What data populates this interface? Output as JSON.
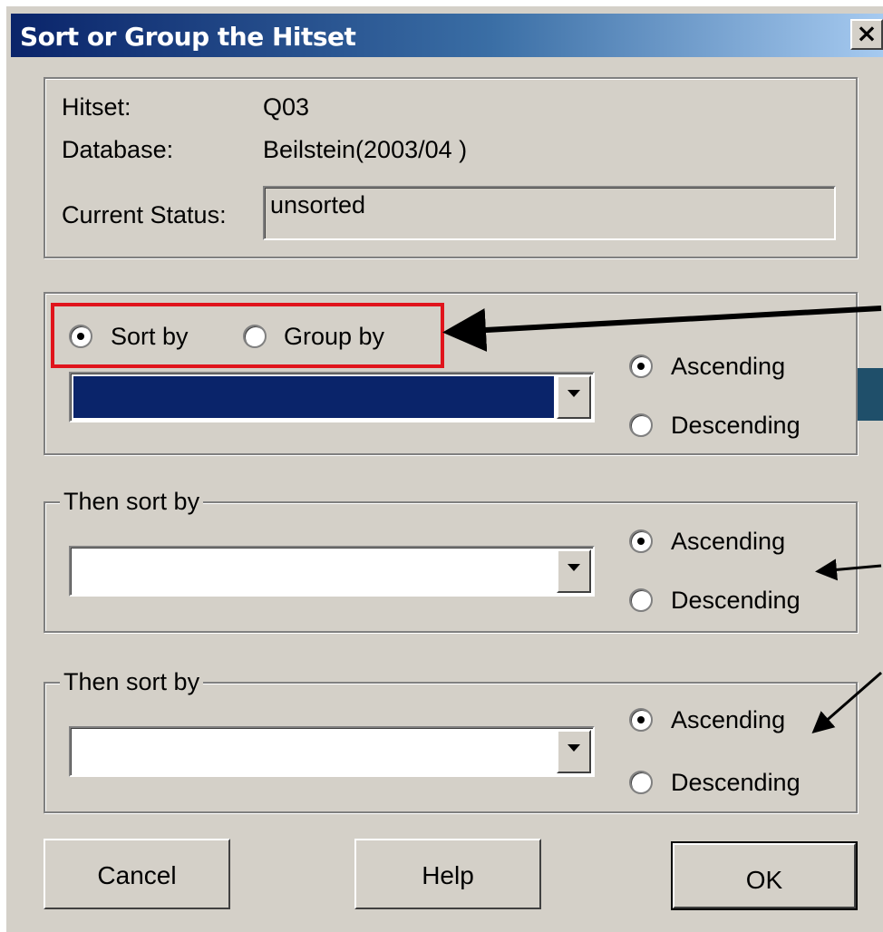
{
  "window": {
    "title": "Sort or Group the Hitset",
    "close_glyph": "×"
  },
  "info": {
    "hitset_label": "Hitset:",
    "hitset_value": "Q03",
    "database_label": "Database:",
    "database_value": "Beilstein(2003/04 )",
    "status_label": "Current Status:",
    "status_value": "unsorted"
  },
  "primary": {
    "sort_by_label": "Sort by",
    "group_by_label": "Group by",
    "selected_mode": "Sort by",
    "ascending_label": "Ascending",
    "descending_label": "Descending",
    "order": "Ascending",
    "field_value": ""
  },
  "secondary": [
    {
      "legend": "Then sort by",
      "ascending_label": "Ascending",
      "descending_label": "Descending",
      "order": "Ascending",
      "field_value": ""
    },
    {
      "legend": "Then sort by",
      "ascending_label": "Ascending",
      "descending_label": "Descending",
      "order": "Ascending",
      "field_value": ""
    }
  ],
  "buttons": {
    "cancel": "Cancel",
    "help": "Help",
    "ok": "OK"
  },
  "colors": {
    "highlight": "#e0141c",
    "selection": "#0a246a",
    "dialog_bg": "#d4d0c8"
  }
}
